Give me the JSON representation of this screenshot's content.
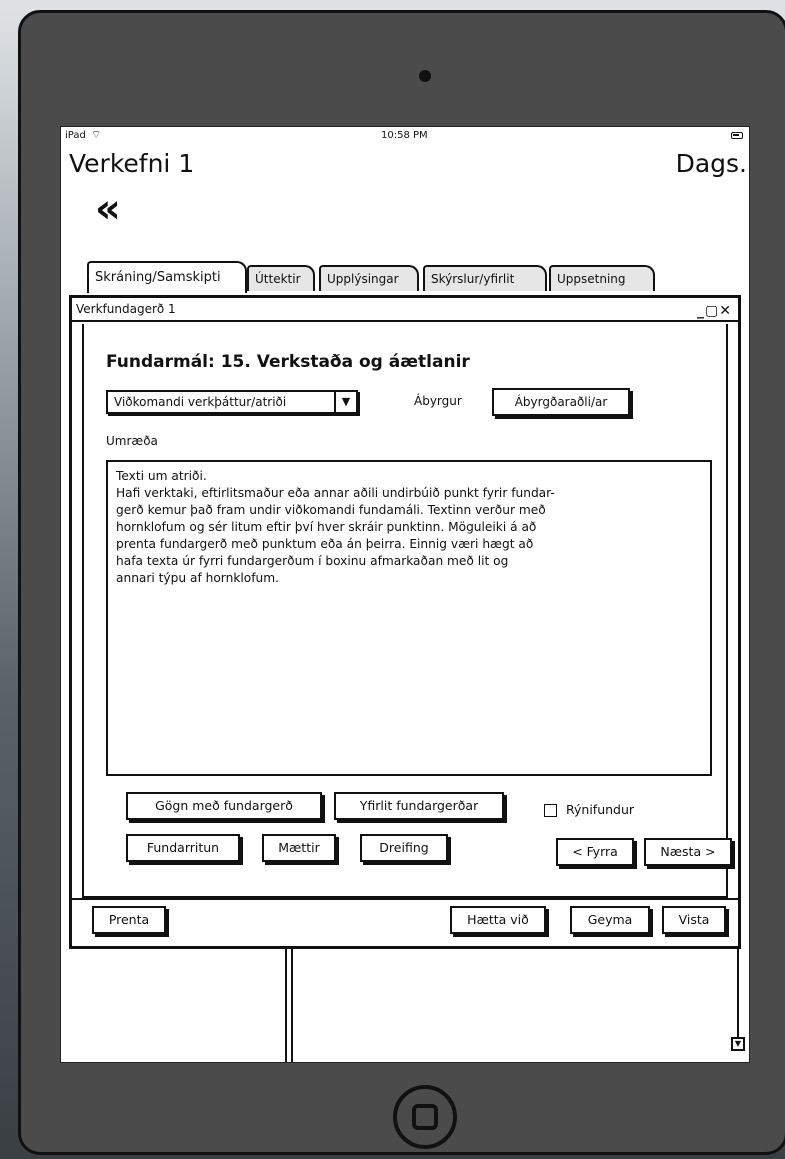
{
  "status_bar": {
    "carrier": "iPad",
    "time": "10:58 PM"
  },
  "header": {
    "project_title": "Verkefni 1",
    "date_label": "Dags.",
    "back_glyph": "«"
  },
  "tabs": [
    {
      "label": "Skráning/Samskipti",
      "active": true
    },
    {
      "label": "Úttektir",
      "active": false
    },
    {
      "label": "Upplýsingar",
      "active": false
    },
    {
      "label": "Skýrslur/yfirlit",
      "active": false
    },
    {
      "label": "Uppsetning",
      "active": false
    }
  ],
  "dialog": {
    "title": "Verkfundagerð 1",
    "window_controls": "_▢✕",
    "topic": "Fundarmál: 15. Verkstaða og áætlanir",
    "select_value": "Viðkomandi verkþáttur/atriði",
    "responsible_label": "Ábyrgur",
    "responsible_button": "Ábyrgðaraðli/ar",
    "discussion_label": "Umræða",
    "discussion_text": "Texti um atriði.\nHafi verktaki, eftirlitsmaður eða annar aðili undirbúið punkt fyrir fundar-\ngerð kemur það fram undir viðkomandi fundamáli. Textinn verður með\nhornklofum og sér litum eftir því hver skráir punktinn. Möguleiki á að\nprenta fundargerð með punktum eða án þeirra. Einnig væri hægt að\nhafa texta úr fyrri fundargerðum í boxinu afmarkaðan með lit og\nannari týpu af hornklofum.",
    "buttons": {
      "documents": "Gögn með fundargerð",
      "overview": "Yfirlit fundargerðar",
      "review_meeting": "Rýnifundur",
      "minutes_taker": "Fundarritun",
      "attended": "Mættir",
      "distribution": "Dreifing",
      "previous": "< Fyrra",
      "next": "Næsta >",
      "print": "Prenta",
      "cancel": "Hætta við",
      "save": "Geyma",
      "store": "Vista"
    }
  },
  "colors": {
    "device": "#4b4b4b",
    "tab_inactive": "#e6e6e6",
    "ink": "#111111"
  }
}
